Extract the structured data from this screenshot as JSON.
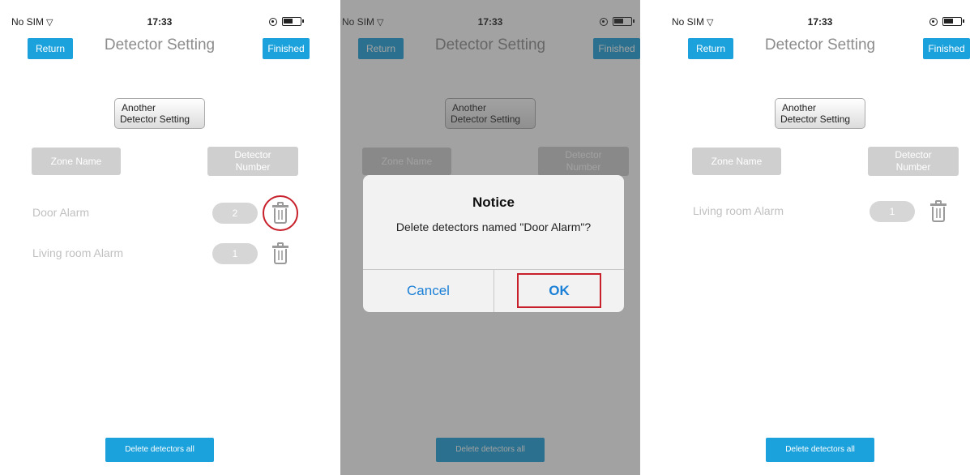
{
  "status_bar": {
    "carrier": "No SIM",
    "wifi": "▽",
    "time": "17:33"
  },
  "nav": {
    "return_label": "Return",
    "title": "Detector Setting",
    "finished_label": "Finished"
  },
  "another_detector": {
    "line1": "Another",
    "line2": "Detector Setting"
  },
  "headers": {
    "zone_name": "Zone Name",
    "detector_number_line1": "Detector",
    "detector_number_line2": "Number"
  },
  "screen1": {
    "rows": [
      {
        "name": "Door Alarm",
        "number": "2"
      },
      {
        "name": "Living room Alarm",
        "number": "1"
      }
    ]
  },
  "screen3": {
    "rows": [
      {
        "name": "Living room Alarm",
        "number": "1"
      }
    ]
  },
  "dialog": {
    "title": "Notice",
    "message": "Delete detectors named \"Door Alarm\"?",
    "cancel_label": "Cancel",
    "ok_label": "OK"
  },
  "footer": {
    "delete_all_label": "Delete detectors all"
  },
  "colors": {
    "accent": "#1ba1db",
    "highlight": "#c8202b",
    "disabled": "#cfcfcf",
    "link": "#1a7fd6"
  }
}
